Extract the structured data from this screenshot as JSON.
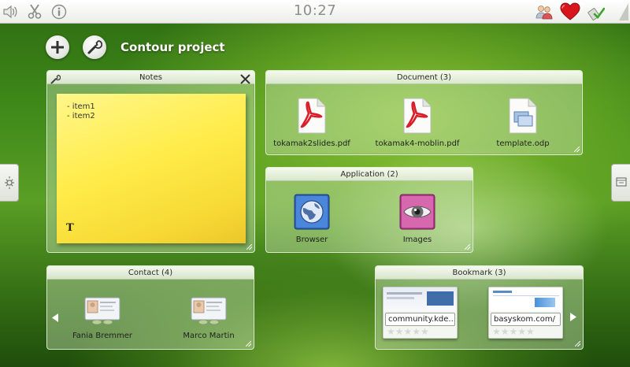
{
  "statusbar": {
    "time": "10:27",
    "left_icons": [
      "volume-icon",
      "scissors-icon",
      "info-icon"
    ],
    "right_icons": [
      "users-icon",
      "heart-icon",
      "clean-icon"
    ]
  },
  "project": {
    "title": "Contour project",
    "add_icon": "plus-icon",
    "settings_icon": "wrench-icon"
  },
  "notes": {
    "title": "Notes",
    "lines": [
      "- item1",
      "- item2"
    ],
    "text_tool": "T"
  },
  "document": {
    "title": "Document (3)",
    "items": [
      {
        "label": "tokamak2slides.pdf",
        "icon": "pdf-icon"
      },
      {
        "label": "tokamak4-moblin.pdf",
        "icon": "pdf-icon"
      },
      {
        "label": "template.odp",
        "icon": "presentation-icon"
      }
    ]
  },
  "application": {
    "title": "Application (2)",
    "items": [
      {
        "label": "Browser",
        "icon": "globe-icon"
      },
      {
        "label": "Images",
        "icon": "eye-icon"
      }
    ]
  },
  "contact": {
    "title": "Contact (4)",
    "items": [
      {
        "label": "Fania Bremmer",
        "icon": "contact-card-icon"
      },
      {
        "label": "Marco Martin",
        "icon": "contact-card-icon"
      }
    ]
  },
  "bookmark": {
    "title": "Bookmark (3)",
    "items": [
      {
        "label": "community.kde...."
      },
      {
        "label": "basyskom.com/"
      }
    ]
  },
  "colors": {
    "note_yellow": "#ffec4a",
    "heart_red": "#d8141c",
    "pdf_red": "#d9202a"
  }
}
